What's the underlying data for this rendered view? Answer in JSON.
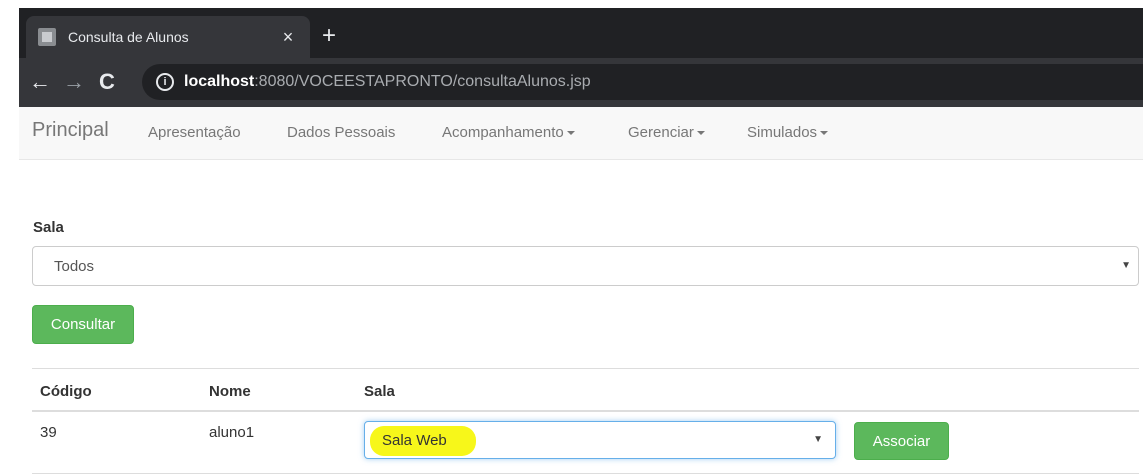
{
  "browser": {
    "tab_title": "Consulta de Alunos",
    "tab_close": "×",
    "new_tab": "+",
    "back": "←",
    "forward": "→",
    "reload": "C",
    "info": "i",
    "url_host": "localhost",
    "url_rest": ":8080/VOCEESTAPRONTO/consultaAlunos.jsp"
  },
  "navbar": {
    "brand": "Principal",
    "items": [
      {
        "label": "Apresentação",
        "dropdown": false
      },
      {
        "label": "Dados Pessoais",
        "dropdown": false
      },
      {
        "label": "Acompanhamento",
        "dropdown": true
      },
      {
        "label": "Gerenciar",
        "dropdown": true
      },
      {
        "label": "Simulados",
        "dropdown": true
      }
    ]
  },
  "form": {
    "sala_label": "Sala",
    "sala_selected": "Todos",
    "select_arrow": "▼",
    "consultar_label": "Consultar"
  },
  "table": {
    "headers": [
      "Código",
      "Nome",
      "Sala"
    ],
    "rows": [
      {
        "codigo": "39",
        "nome": "aluno1",
        "sala": "Sala Web",
        "action": "Associar"
      }
    ]
  },
  "colors": {
    "success": "#5cb85c",
    "highlight": "#f7f71a",
    "chrome_dark": "#202124"
  }
}
